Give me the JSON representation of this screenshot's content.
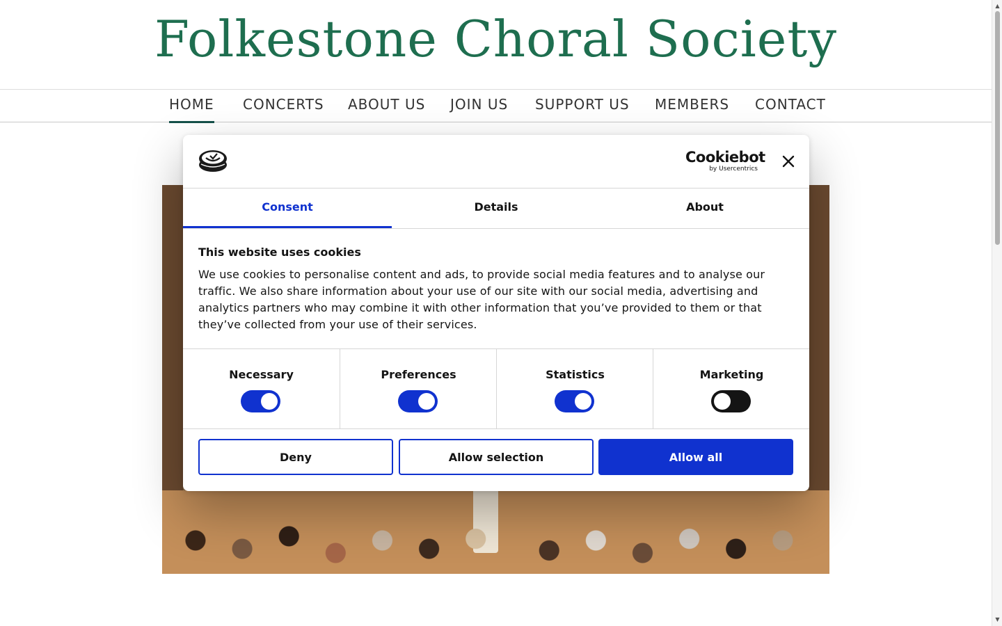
{
  "site": {
    "title": "Folkestone Choral Society"
  },
  "nav": {
    "items": [
      {
        "label": "HOME",
        "active": true
      },
      {
        "label": "CONCERTS",
        "active": false
      },
      {
        "label": "ABOUT US",
        "active": false
      },
      {
        "label": "JOIN US",
        "active": false
      },
      {
        "label": "SUPPORT US",
        "active": false
      },
      {
        "label": "MEMBERS",
        "active": false
      },
      {
        "label": "CONTACT",
        "active": false
      }
    ]
  },
  "cookie_dialog": {
    "brand": {
      "name": "Cookiebot",
      "sub": "by Usercentrics"
    },
    "tabs": [
      {
        "label": "Consent",
        "active": true
      },
      {
        "label": "Details",
        "active": false
      },
      {
        "label": "About",
        "active": false
      }
    ],
    "heading": "This website uses cookies",
    "body": "We use cookies to personalise content and ads, to provide social media features and to analyse our traffic. We also share information about your use of our site with our social media, advertising and analytics partners who may combine it with other information that you’ve provided to them or that they’ve collected from your use of their services.",
    "categories": [
      {
        "label": "Necessary",
        "enabled": true
      },
      {
        "label": "Preferences",
        "enabled": true
      },
      {
        "label": "Statistics",
        "enabled": true
      },
      {
        "label": "Marketing",
        "enabled": false
      }
    ],
    "buttons": {
      "deny": "Deny",
      "allow_selection": "Allow selection",
      "allow_all": "Allow all"
    }
  },
  "icons": {
    "site_logo": "site-logo-icon",
    "close": "close-icon",
    "scroll_up": "chevron-up-icon",
    "scroll_down": "chevron-down-icon"
  },
  "colors": {
    "title_green": "#1e6e4f",
    "nav_active_underline": "#15514a",
    "accent_blue": "#1032cf",
    "toggle_off": "#141414"
  }
}
